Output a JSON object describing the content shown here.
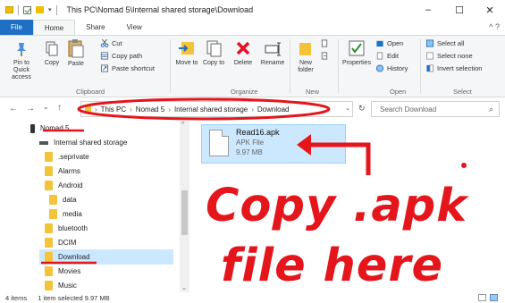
{
  "window": {
    "title": "This PC\\Nomad 5\\Internal shared storage\\Download",
    "minimize": "–",
    "maximize": "☐",
    "close": "✕"
  },
  "ribbon_tabs": [
    "File",
    "Home",
    "Share",
    "View"
  ],
  "ribbon_help": "^ ?",
  "ribbon": {
    "pin_to_quick_access": "Pin to Quick access",
    "copy": "Copy",
    "paste": "Paste",
    "cut": "Cut",
    "copy_path": "Copy path",
    "paste_shortcut": "Paste shortcut",
    "move_to": "Move to",
    "copy_to": "Copy to",
    "delete": "Delete",
    "rename": "Rename",
    "new_folder": "New folder",
    "properties": "Properties",
    "open": "Open",
    "edit": "Edit",
    "history": "History",
    "select_all": "Select all",
    "select_none": "Select none",
    "invert_selection": "Invert selection",
    "groups": [
      "Clipboard",
      "Organize",
      "New",
      "Open",
      "Select"
    ]
  },
  "address": {
    "crumbs": [
      "This PC",
      "Nomad 5",
      "Internal shared storage",
      "Download"
    ],
    "search_placeholder": "Search Download"
  },
  "nav_pane": {
    "device": "Nomad 5",
    "storage": "Internal shared storage",
    "folders": [
      ".seprivate",
      "Alarms",
      "Android",
      "data",
      "media",
      "bluetooth",
      "DCIM",
      "Download",
      "Movies",
      "Music"
    ]
  },
  "file": {
    "name": "Read16.apk",
    "type": "APK File",
    "size": "9.97 MB"
  },
  "annotation": {
    "line1": "Copy .apk",
    "line2": "file here"
  },
  "status": {
    "items": "4 items",
    "selected": "1 item selected  9.97 MB"
  },
  "colors": {
    "accent": "#1f6fc4",
    "selection": "#cce8ff",
    "annotation_red": "#e4161c",
    "folder": "#f3c43a"
  }
}
